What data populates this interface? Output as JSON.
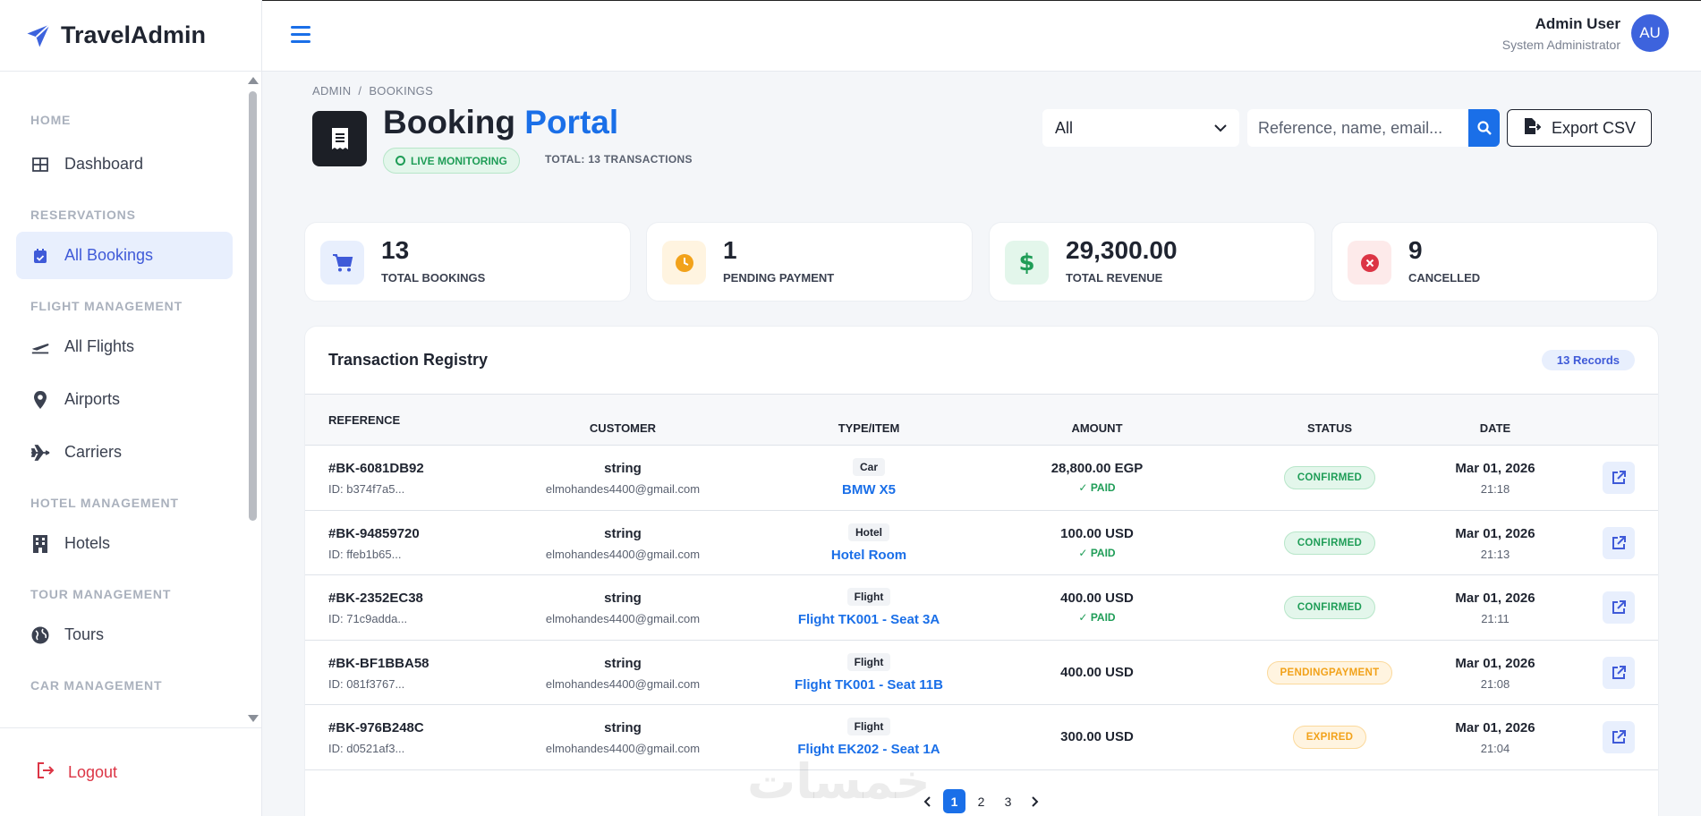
{
  "brand": {
    "name": "TravelAdmin"
  },
  "sidebar": {
    "sections": [
      {
        "title": "HOME",
        "items": [
          {
            "label": "Dashboard",
            "icon": "dashboard-icon"
          }
        ]
      },
      {
        "title": "RESERVATIONS",
        "items": [
          {
            "label": "All Bookings",
            "icon": "calendar-check-icon",
            "active": true
          }
        ]
      },
      {
        "title": "FLIGHT MANAGEMENT",
        "items": [
          {
            "label": "All Flights",
            "icon": "plane-departure-icon"
          },
          {
            "label": "Airports",
            "icon": "map-pin-icon"
          },
          {
            "label": "Carriers",
            "icon": "plane-icon"
          }
        ]
      },
      {
        "title": "HOTEL MANAGEMENT",
        "items": [
          {
            "label": "Hotels",
            "icon": "building-icon"
          }
        ]
      },
      {
        "title": "TOUR MANAGEMENT",
        "items": [
          {
            "label": "Tours",
            "icon": "globe-icon"
          }
        ]
      },
      {
        "title": "CAR MANAGEMENT",
        "items": []
      }
    ],
    "logout": "Logout"
  },
  "topbar": {
    "user_name": "Admin User",
    "user_role": "System Administrator",
    "avatar_initials": "AU"
  },
  "header": {
    "breadcrumb": [
      "ADMIN",
      "BOOKINGS"
    ],
    "title_main": "Booking",
    "title_accent": "Portal",
    "live_label": "LIVE MONITORING",
    "total_label": "TOTAL: 13 TRANSACTIONS",
    "filter_value": "All",
    "search_placeholder": "Reference, name, email...",
    "export_label": "Export CSV"
  },
  "stats": [
    {
      "value": "13",
      "label": "TOTAL BOOKINGS",
      "icon": "cart-icon",
      "color": "#3f5ad8",
      "bg": "#e8effd"
    },
    {
      "value": "1",
      "label": "PENDING PAYMENT",
      "icon": "clock-icon",
      "color": "#f2a21a",
      "bg": "#fff4e0"
    },
    {
      "value": "29,300.00",
      "label": "TOTAL REVENUE",
      "icon": "dollar-icon",
      "color": "#1f9d57",
      "bg": "#e3f6eb"
    },
    {
      "value": "9",
      "label": "CANCELLED",
      "icon": "x-circle-icon",
      "color": "#dc3545",
      "bg": "#fdeaea"
    }
  ],
  "table": {
    "title": "Transaction Registry",
    "records_badge": "13 Records",
    "columns": [
      "REFERENCE",
      "CUSTOMER",
      "TYPE/ITEM",
      "AMOUNT",
      "STATUS",
      "DATE"
    ],
    "rows": [
      {
        "ref": "#BK-6081DB92",
        "id": "ID: b374f7a5...",
        "name": "string",
        "email": "elmohandes4400@gmail.com",
        "type": "Car",
        "item": "BMW X5",
        "amount": "28,800.00 EGP",
        "paid": "PAID",
        "status": "CONFIRMED",
        "date": "Mar 01, 2026",
        "time": "21:18"
      },
      {
        "ref": "#BK-94859720",
        "id": "ID: ffeb1b65...",
        "name": "string",
        "email": "elmohandes4400@gmail.com",
        "type": "Hotel",
        "item": "Hotel Room",
        "amount": "100.00 USD",
        "paid": "PAID",
        "status": "CONFIRMED",
        "date": "Mar 01, 2026",
        "time": "21:13"
      },
      {
        "ref": "#BK-2352EC38",
        "id": "ID: 71c9adda...",
        "name": "string",
        "email": "elmohandes4400@gmail.com",
        "type": "Flight",
        "item": "Flight TK001 - Seat 3A",
        "amount": "400.00 USD",
        "paid": "PAID",
        "status": "CONFIRMED",
        "date": "Mar 01, 2026",
        "time": "21:11"
      },
      {
        "ref": "#BK-BF1BBA58",
        "id": "ID: 081f3767...",
        "name": "string",
        "email": "elmohandes4400@gmail.com",
        "type": "Flight",
        "item": "Flight TK001 - Seat 11B",
        "amount": "400.00 USD",
        "paid": "",
        "status": "PENDINGPAYMENT",
        "date": "Mar 01, 2026",
        "time": "21:08"
      },
      {
        "ref": "#BK-976B248C",
        "id": "ID: d0521af3...",
        "name": "string",
        "email": "elmohandes4400@gmail.com",
        "type": "Flight",
        "item": "Flight EK202 - Seat 1A",
        "amount": "300.00 USD",
        "paid": "",
        "status": "EXPIRED",
        "date": "Mar 01, 2026",
        "time": "21:04"
      }
    ]
  },
  "pagination": {
    "pages": [
      "1",
      "2",
      "3"
    ],
    "current": "1"
  },
  "watermark": "خمسات"
}
